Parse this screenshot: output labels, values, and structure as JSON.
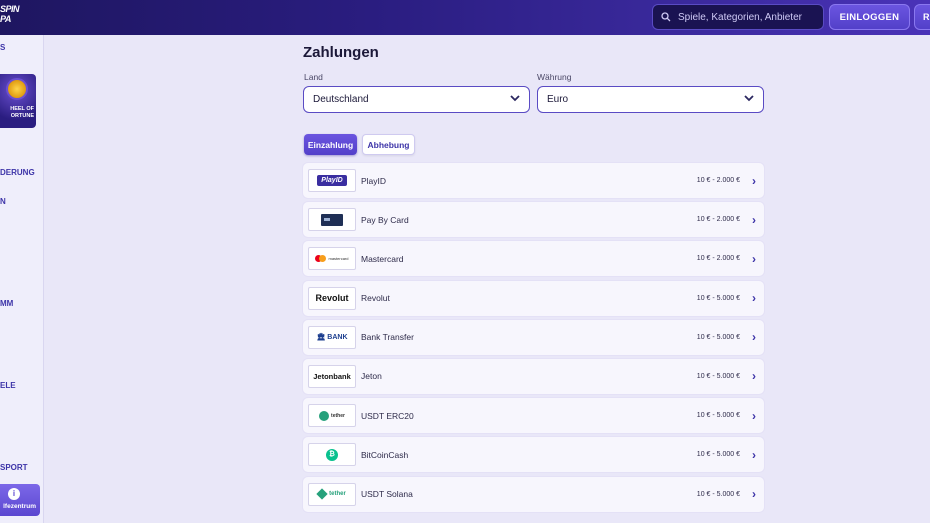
{
  "header": {
    "logo_text": "SPIN\nPA",
    "search_placeholder": "Spiele, Kategorien, Anbieter",
    "login_label": "EINLOGGEN",
    "extra_label": "R"
  },
  "sidebar": {
    "top_label": "S",
    "wheel_label": "HEEL OF\nORTUNE",
    "items": [
      "DERUNG",
      "N",
      "MM",
      "ELE",
      "SPORT"
    ],
    "help_label": "lfezentrum"
  },
  "main": {
    "title": "Zahlungen",
    "country_label": "Land",
    "country_value": "Deutschland",
    "currency_label": "Währung",
    "currency_value": "Euro",
    "tabs": [
      {
        "label": "Einzahlung",
        "active": true
      },
      {
        "label": "Abhebung",
        "active": false
      }
    ],
    "methods": [
      {
        "logo": "PlayID",
        "name": "PlayID",
        "range": "10 € - 2.000 €"
      },
      {
        "logo": "",
        "name": "Pay By Card",
        "range": "10 € - 2.000 €"
      },
      {
        "logo": "mastercard",
        "name": "Mastercard",
        "range": "10 € - 2.000 €"
      },
      {
        "logo": "Revolut",
        "name": "Revolut",
        "range": "10 € - 5.000 €"
      },
      {
        "logo": "BANK",
        "name": "Bank Transfer",
        "range": "10 € - 5.000 €"
      },
      {
        "logo": "Jetonbank",
        "name": "Jeton",
        "range": "10 € - 5.000 €"
      },
      {
        "logo": "tether",
        "name": "USDT ERC20",
        "range": "10 € - 5.000 €"
      },
      {
        "logo": "",
        "name": "BitCoinCash",
        "range": "10 € - 5.000 €"
      },
      {
        "logo": "tether",
        "name": "USDT Solana",
        "range": "10 € - 5.000 €"
      }
    ]
  }
}
